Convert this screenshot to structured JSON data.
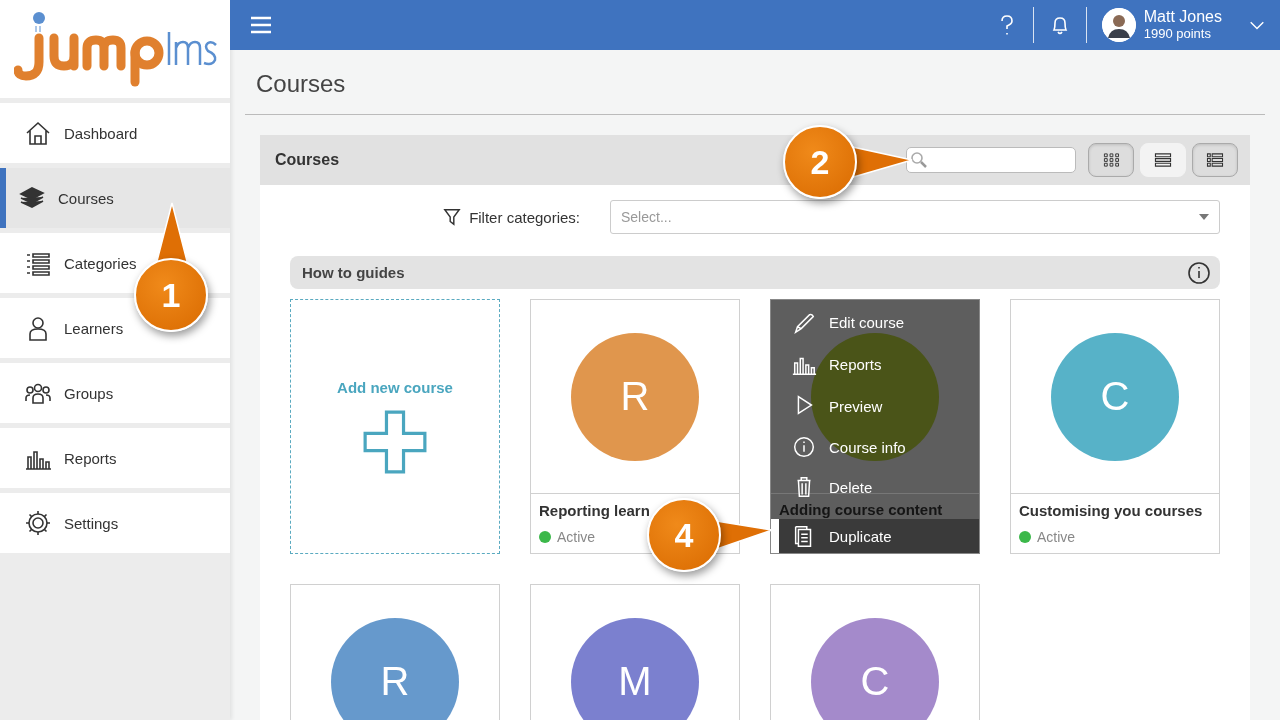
{
  "header": {
    "user_name": "Matt Jones",
    "points": "1990 points"
  },
  "sidebar": {
    "items": [
      {
        "label": "Dashboard",
        "kind": "home",
        "selected": false
      },
      {
        "label": "Courses",
        "kind": "books",
        "selected": true
      },
      {
        "label": "Categories",
        "kind": "list",
        "selected": false
      },
      {
        "label": "Learners",
        "kind": "person",
        "selected": false
      },
      {
        "label": "Groups",
        "kind": "people",
        "selected": false
      },
      {
        "label": "Reports",
        "kind": "bars",
        "selected": false
      },
      {
        "label": "Settings",
        "kind": "gear",
        "selected": false
      }
    ]
  },
  "page_title": "Courses",
  "panel": {
    "title": "Courses",
    "view_buttons": [
      {
        "kind": "grid",
        "selected": false
      },
      {
        "kind": "rows",
        "selected": true
      },
      {
        "kind": "list",
        "selected": false
      }
    ],
    "filter": {
      "label": "Filter categories:",
      "placeholder": "Select..."
    },
    "section": {
      "title": "How to guides"
    },
    "add_card": {
      "label": "Add new course"
    },
    "courses": [
      {
        "letter": "R",
        "title": "Reporting learn",
        "status": "Active",
        "color": "#e0964d",
        "menu_open": false
      },
      {
        "title": "Adding course content",
        "color": "#4a5418",
        "menu_open": true
      },
      {
        "letter": "C",
        "title": "Customising you courses",
        "status": "Active",
        "color": "#57b2c8",
        "menu_open": false
      },
      {
        "letter": "R",
        "color": "#6699cc",
        "menu_open": false
      },
      {
        "letter": "M",
        "color": "#7b80cf",
        "menu_open": false
      },
      {
        "letter": "C",
        "color": "#a48acb",
        "menu_open": false
      }
    ],
    "course_menu": {
      "items": [
        {
          "label": "Edit course",
          "kind": "pencil",
          "selected": false
        },
        {
          "label": "Reports",
          "kind": "bars",
          "selected": false
        },
        {
          "label": "Preview",
          "kind": "play",
          "selected": false
        },
        {
          "label": "Course info",
          "kind": "info",
          "selected": false
        },
        {
          "label": "Delete",
          "kind": "trash",
          "selected": false
        },
        {
          "label": "Duplicate",
          "kind": "copy",
          "selected": true
        }
      ]
    }
  },
  "callouts": [
    {
      "number": "1"
    },
    {
      "number": "2"
    },
    {
      "number": "4"
    }
  ]
}
